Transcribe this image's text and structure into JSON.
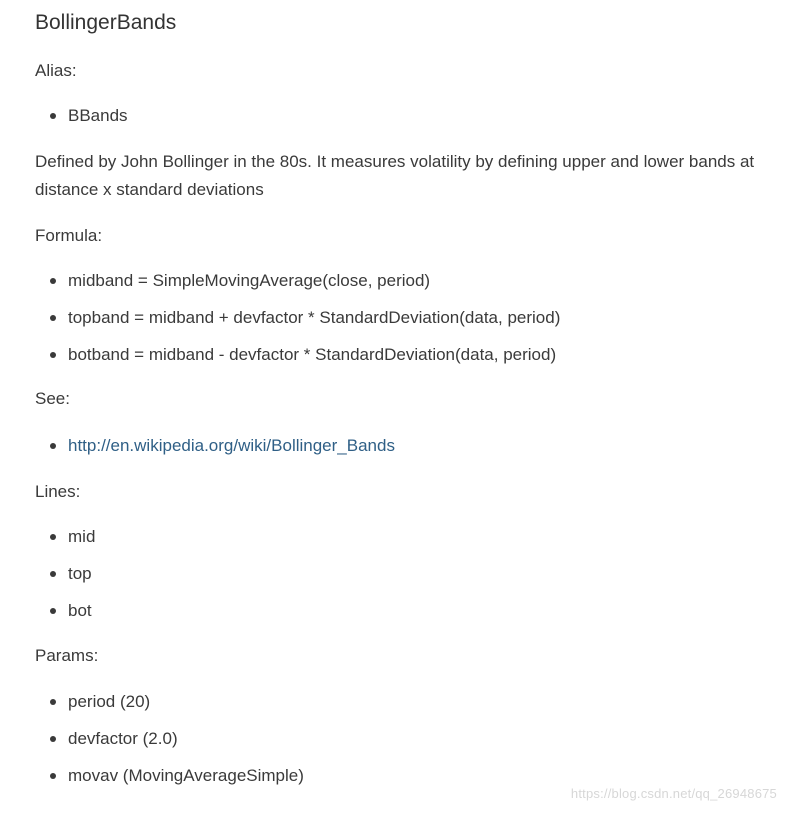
{
  "title": "BollingerBands",
  "alias": {
    "label": "Alias:",
    "items": [
      "BBands"
    ]
  },
  "description": "Defined by John Bollinger in the 80s. It measures volatility by defining upper and lower bands at distance x standard deviations",
  "formula": {
    "label": "Formula:",
    "items": [
      "midband = SimpleMovingAverage(close, period)",
      "topband = midband + devfactor * StandardDeviation(data, period)",
      "botband = midband - devfactor * StandardDeviation(data, period)"
    ]
  },
  "see": {
    "label": "See:",
    "items": [
      "http://en.wikipedia.org/wiki/Bollinger_Bands"
    ]
  },
  "lines": {
    "label": "Lines:",
    "items": [
      "mid",
      "top",
      "bot"
    ]
  },
  "params": {
    "label": "Params:",
    "items": [
      "period (20)",
      "devfactor (2.0)",
      "movav (MovingAverageSimple)"
    ]
  },
  "watermark": "https://blog.csdn.net/qq_26948675",
  "colors": {
    "text": "#3a3a3a",
    "link": "#2f5f86",
    "watermark": "#d7d7d7"
  }
}
